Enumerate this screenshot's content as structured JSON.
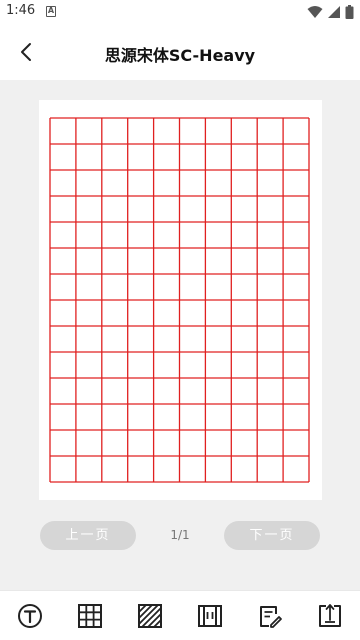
{
  "status": {
    "time": "1:46",
    "notification_glyph": "A"
  },
  "header": {
    "title": "思源宋体SC-Heavy"
  },
  "pager": {
    "prev_label": "上一页",
    "next_label": "下一页",
    "indicator": "1/1"
  },
  "grid": {
    "columns": 10,
    "rows": 14,
    "line_color": "#e02020"
  },
  "toolbar": {
    "items": [
      {
        "icon": "text-icon"
      },
      {
        "icon": "grid-icon"
      },
      {
        "icon": "hatch-pattern-icon"
      },
      {
        "icon": "layout-icon"
      },
      {
        "icon": "edit-note-icon"
      },
      {
        "icon": "export-icon"
      }
    ]
  },
  "colors": {
    "accent_red": "#e02020",
    "background": "#f0f0f0",
    "button_disabled": "#d6d6d6"
  }
}
